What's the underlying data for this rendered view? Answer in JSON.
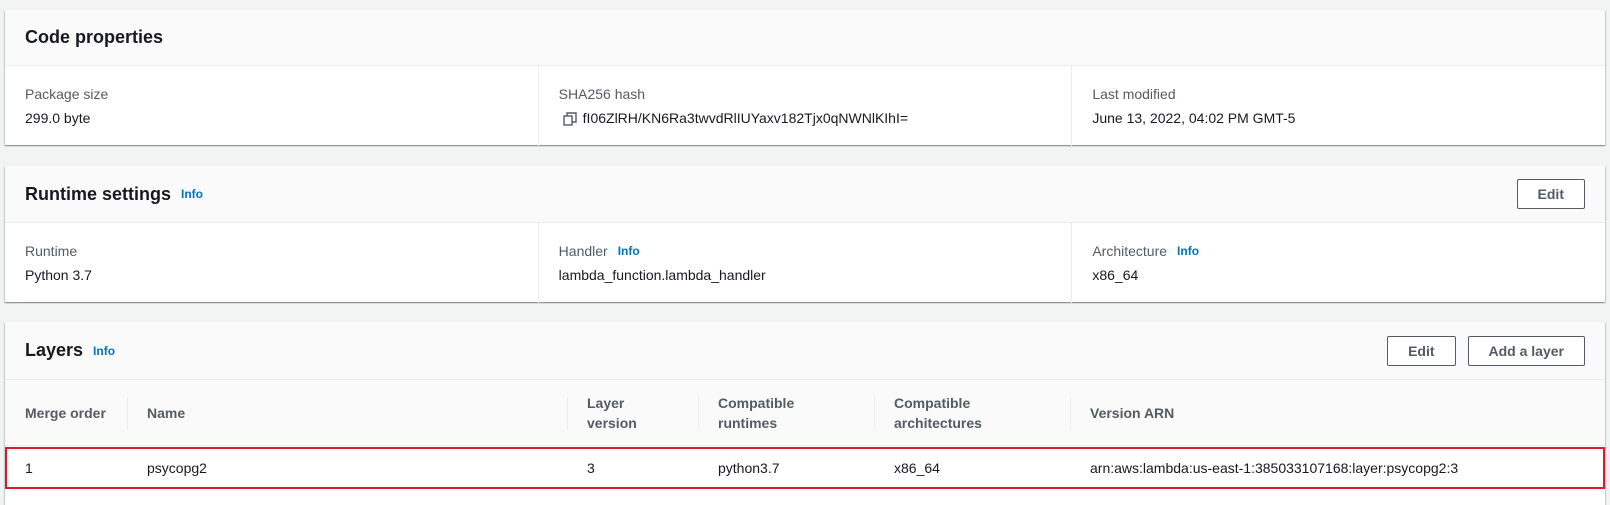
{
  "code_properties": {
    "title": "Code properties",
    "package_size_label": "Package size",
    "package_size_value": "299.0 byte",
    "sha_label": "SHA256 hash",
    "sha_value": "fI06ZlRH/KN6Ra3twvdRlIUYaxv182Tjx0qNWNlKIhI=",
    "last_modified_label": "Last modified",
    "last_modified_value": "June 13, 2022, 04:02 PM GMT-5"
  },
  "runtime_settings": {
    "title": "Runtime settings",
    "info": "Info",
    "edit_label": "Edit",
    "runtime_label": "Runtime",
    "runtime_value": "Python 3.7",
    "handler_label": "Handler",
    "handler_info": "Info",
    "handler_value": "lambda_function.lambda_handler",
    "architecture_label": "Architecture",
    "architecture_info": "Info",
    "architecture_value": "x86_64"
  },
  "layers": {
    "title": "Layers",
    "info": "Info",
    "edit_label": "Edit",
    "add_label": "Add a layer",
    "columns": {
      "merge_order": "Merge order",
      "name": "Name",
      "layer_version": "Layer version",
      "compatible_runtimes_1": "Compatible",
      "compatible_runtimes_2": "runtimes",
      "compatible_architectures_1": "Compatible",
      "compatible_architectures_2": "architectures",
      "version_arn": "Version ARN"
    },
    "rows": [
      {
        "merge_order": "1",
        "name": "psycopg2",
        "layer_version": "3",
        "compatible_runtimes": "python3.7",
        "compatible_architectures": "x86_64",
        "version_arn": "arn:aws:lambda:us-east-1:385033107168:layer:psycopg2:3"
      }
    ]
  },
  "colors": {
    "link": "#0073bb",
    "highlight_border": "#e0182d"
  },
  "icons": {
    "copy": "copy-icon"
  }
}
